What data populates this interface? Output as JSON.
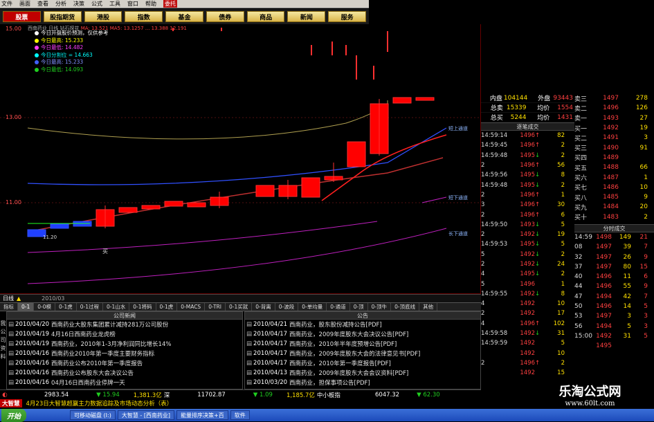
{
  "menu": [
    "文件",
    "画面",
    "查看",
    "分析",
    "决策",
    "公式",
    "工具",
    "窗口",
    "帮助",
    "委托"
  ],
  "nav": [
    "股票",
    "股指期货",
    "港股",
    "指数",
    "基金",
    "债券",
    "商品",
    "新闻",
    "服务"
  ],
  "chart": {
    "info_name": "西南药业 日线",
    "info_rest": "钻石探花",
    "info_vals": "MA: 13.521  MA5: 13.1257  ... 13.388  12.191",
    "legend": [
      {
        "c": "#ffffff",
        "t": "今日开盘股价预测，仅供参考"
      },
      {
        "c": "#ffff00",
        "t": "今日最高: 15.233"
      },
      {
        "c": "#ff40ff",
        "t": "今日最低: 14.482"
      },
      {
        "c": "#00ffff",
        "t": "今日分割位 = 14.663"
      },
      {
        "c": "#4060ff",
        "t": "今日最高: 15.233"
      },
      {
        "c": "#20d020",
        "t": "今日最低: 14.093"
      }
    ],
    "price_labels": [
      "15.00",
      "13.00",
      "11.00"
    ],
    "buy": "买",
    "low_price": "11.20",
    "channels": {
      "upper": "短上通道",
      "lower": "短下通道",
      "long": "长下通道"
    },
    "bottom_left": "日线",
    "bottom_date": "2010/03"
  },
  "indicator_tabs": [
    "指标",
    "0-1",
    "0-0模",
    "0-1虎",
    "0-1过程",
    "0-1山水",
    "0-1将码",
    "0-1虎",
    "0-MACS",
    "0-TRI",
    "0-1买就",
    "0-背离",
    "0-波段",
    "0-单均量",
    "0-通道",
    "0-顶",
    "0-顶牛",
    "0-顶底线",
    "其他"
  ],
  "news_left": {
    "title": "公司新闻",
    "side": "我 公 司 资 料",
    "rows": [
      {
        "d": "2010/04/20",
        "t": "西南药业大股东集团累计减持281万公司股份"
      },
      {
        "d": "2010/04/19",
        "t": "4月16日西南药业龙虎榜"
      },
      {
        "d": "2010/04/19",
        "t": "西南药业，2010年1-3月净利润同比增长14%"
      },
      {
        "d": "2010/04/16",
        "t": "西南药业2010年第一季度主要财务指标"
      },
      {
        "d": "2010/04/16",
        "t": "西南药业公布2010年第一季度报告"
      },
      {
        "d": "2010/04/16",
        "t": "西南药业公布股东大会决议公告"
      },
      {
        "d": "2010/04/16",
        "t": "04月16日西南药业停牌一天"
      }
    ]
  },
  "news_right": {
    "title": "公告",
    "rows": [
      {
        "d": "2010/04/21",
        "t": "西南药业，股东股份减持公告[PDF]"
      },
      {
        "d": "2010/04/17",
        "t": "西南药业，2009年度股东大会决议公告[PDF]"
      },
      {
        "d": "2010/04/17",
        "t": "西南药业，2010年半年度预增公告[PDF]"
      },
      {
        "d": "2010/04/17",
        "t": "西南药业，2009年度股东大会的法律意见书[PDF]"
      },
      {
        "d": "2010/04/17",
        "t": "西南药业，2010年第一季度报告[PDF]"
      },
      {
        "d": "2010/04/13",
        "t": "西南药业，2009年度股东大会会议资料[PDF]"
      },
      {
        "d": "2010/03/20",
        "t": "西南药业，担保事项公告[PDF]"
      }
    ]
  },
  "status": {
    "idx1": "2983.54",
    "chg1": "15.94",
    "amt1": "1,381.3亿",
    "m1": "深",
    "idx2": "11702.87",
    "chg2": "1.09",
    "amt2": "1,185.7亿",
    "m2": "中小板指",
    "idx3": "6047.32",
    "chg3": "62.30"
  },
  "ticker": {
    "logo": "大智慧",
    "text": "4月23日大智慧超赢主力数据追踪及市场动态分析（表）"
  },
  "taskbar": {
    "start": "开始",
    "tasks": [
      "可移动磁盘 (I:)",
      "大智慧 - [西南药业]",
      "能量排序决策+百",
      "软件"
    ]
  },
  "quote": [
    {
      "a": "内盘",
      "b": "104144",
      "c": "外盘",
      "d": "93443"
    },
    {
      "a": "总卖",
      "b": "15339",
      "c": "均价",
      "d": "1554"
    },
    {
      "a": "总买",
      "b": "5244",
      "c": "均价",
      "d": "1431"
    }
  ],
  "trades_title": "逐笔成交",
  "trades": [
    {
      "t": "14:59:14",
      "p": "1496",
      "s": "↑",
      "v": "82"
    },
    {
      "t": "14:59:45",
      "p": "1496",
      "s": "↑",
      "v": "2"
    },
    {
      "t": "14:59:48",
      "p": "1495",
      "s": "↓",
      "v": "2"
    },
    {
      "t": "2",
      "p": "1496",
      "s": "↑",
      "v": "56"
    },
    {
      "t": "14:59:56",
      "p": "1495",
      "s": "↓",
      "v": "8"
    },
    {
      "t": "14:59:48",
      "p": "1495",
      "s": "↓",
      "v": "2"
    },
    {
      "t": "2",
      "p": "1496",
      "s": "↑",
      "v": "1"
    },
    {
      "t": "3",
      "p": "1496",
      "s": "↑",
      "v": "30"
    },
    {
      "t": "2",
      "p": "1496",
      "s": "↑",
      "v": "6"
    },
    {
      "t": "14:59:50",
      "p": "1493",
      "s": "↓",
      "v": "5"
    },
    {
      "t": "2",
      "p": "1492",
      "s": "↓",
      "v": "19"
    },
    {
      "t": "14:59:53",
      "p": "1495",
      "s": "↓",
      "v": "5"
    },
    {
      "t": "5",
      "p": "1492",
      "s": "↓",
      "v": "2"
    },
    {
      "t": "2",
      "p": "1492",
      "s": "↓",
      "v": "24"
    },
    {
      "t": "4",
      "p": "1495",
      "s": "↓",
      "v": "2"
    },
    {
      "t": "5",
      "p": "1496",
      "s": "",
      "v": "1"
    },
    {
      "t": "14:59:55",
      "p": "1492",
      "s": "↓",
      "v": "8"
    },
    {
      "t": "4",
      "p": "1492",
      "s": "",
      "v": "10"
    },
    {
      "t": "2",
      "p": "1492",
      "s": "",
      "v": "17"
    },
    {
      "t": "4",
      "p": "1496",
      "s": "↑",
      "v": "102"
    },
    {
      "t": "14:59:58",
      "p": "1492",
      "s": "↓",
      "v": "31"
    },
    {
      "t": "14:59:59",
      "p": "1492",
      "s": "",
      "v": "5"
    },
    {
      "t": "",
      "p": "1492",
      "s": "",
      "v": "10"
    },
    {
      "t": "2",
      "p": "1496",
      "s": "↑",
      "v": "2"
    },
    {
      "t": "",
      "p": "1492",
      "s": "",
      "v": "15"
    }
  ],
  "book_top": [
    {
      "l": "卖三",
      "p": "1497",
      "v": "278"
    },
    {
      "l": "卖二",
      "p": "1496",
      "v": "126"
    },
    {
      "l": "卖一",
      "p": "1493",
      "v": "27"
    }
  ],
  "book_buy": [
    {
      "l": "买一",
      "p": "1492",
      "v": "19"
    },
    {
      "l": "买二",
      "p": "1491",
      "v": "3"
    },
    {
      "l": "买三",
      "p": "1490",
      "v": "91"
    },
    {
      "l": "买四",
      "p": "1489",
      "v": ""
    },
    {
      "l": "买五",
      "p": "1488",
      "v": "66"
    },
    {
      "l": "买六",
      "p": "1487",
      "v": "1"
    },
    {
      "l": "买七",
      "p": "1486",
      "v": "10"
    },
    {
      "l": "买八",
      "p": "1485",
      "v": "9"
    },
    {
      "l": "买九",
      "p": "1484",
      "v": "20"
    },
    {
      "l": "买十",
      "p": "1483",
      "v": "2"
    }
  ],
  "fen_title": "分时成交",
  "fen": [
    {
      "t": "14:59",
      "p": "1498",
      "v": "149",
      "n": "21"
    },
    {
      "t": "08",
      "p": "1497",
      "v": "39",
      "n": "7"
    },
    {
      "t": "32",
      "p": "1497",
      "v": "26",
      "n": "9"
    },
    {
      "t": "37",
      "p": "1497",
      "v": "80",
      "n": "15"
    },
    {
      "t": "40",
      "p": "1496",
      "v": "11",
      "n": "6"
    },
    {
      "t": "44",
      "p": "1496",
      "v": "55",
      "n": "9"
    },
    {
      "t": "47",
      "p": "1494",
      "v": "42",
      "n": "7"
    },
    {
      "t": "50",
      "p": "1496",
      "v": "14",
      "n": "5"
    },
    {
      "t": "53",
      "p": "1497",
      "v": "3",
      "n": "3"
    },
    {
      "t": "56",
      "p": "1494",
      "v": "5",
      "n": "3"
    },
    {
      "t": "15:00",
      "p": "1492",
      "v": "31",
      "n": "5"
    },
    {
      "t": "",
      "p": "1495",
      "v": "",
      "n": ""
    }
  ],
  "watermark": {
    "a": "乐淘公式网",
    "b": "www.60lt.com"
  }
}
